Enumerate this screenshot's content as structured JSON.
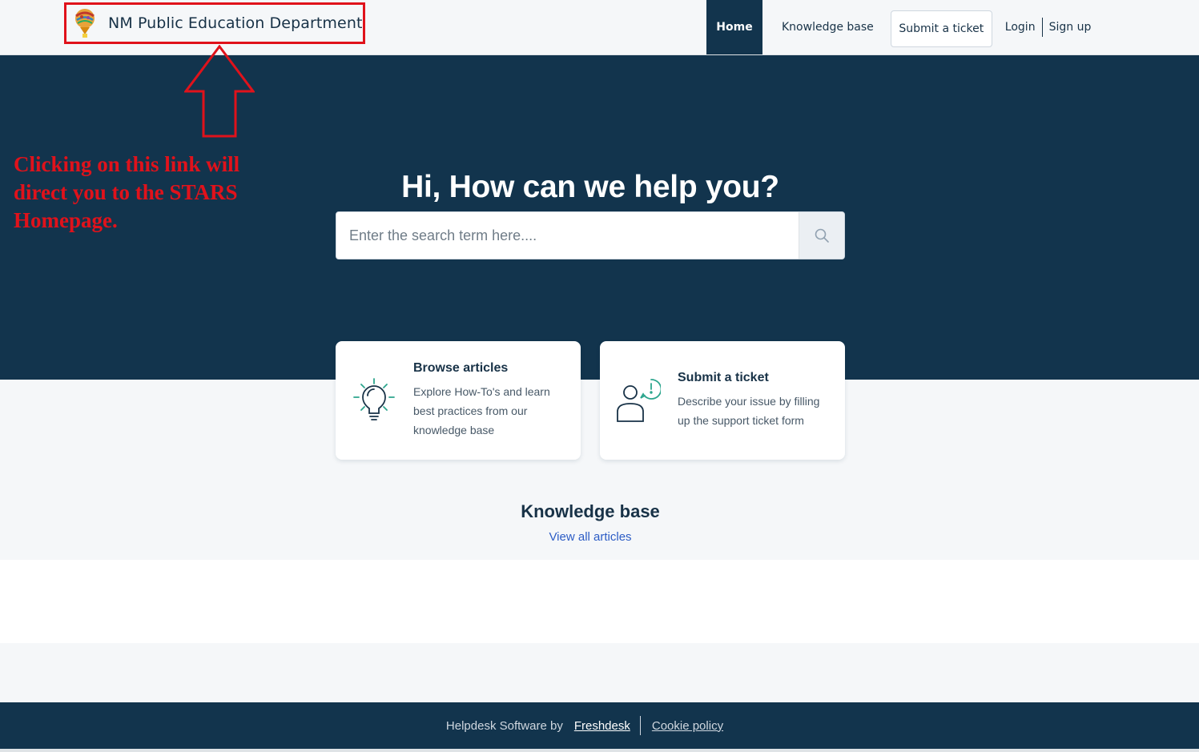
{
  "header": {
    "brand_name": "NM Public Education Department",
    "nav": {
      "home": "Home",
      "knowledge_base": "Knowledge base",
      "submit_ticket": "Submit a ticket",
      "login": "Login",
      "signup": "Sign up"
    }
  },
  "hero": {
    "title": "Hi, How can we help you?",
    "search": {
      "placeholder": "Enter the search term here....",
      "value": ""
    }
  },
  "annotation": {
    "text": "Clicking on this link will direct you to the STARS Homepage."
  },
  "cards": [
    {
      "title": "Browse articles",
      "description": "Explore How-To's and learn best practices from our knowledge base",
      "icon": "lightbulb-icon"
    },
    {
      "title": "Submit a ticket",
      "description": "Describe your issue by filling up the support ticket form",
      "icon": "user-alert-icon"
    }
  ],
  "knowledge_base": {
    "title": "Knowledge base",
    "view_all": "View all articles"
  },
  "footer": {
    "label": "Helpdesk Software by",
    "link": "Freshdesk",
    "cookie": "Cookie policy"
  },
  "colors": {
    "primary": "#12344d",
    "annotation_red": "#e0121b",
    "link_blue": "#2c5cc5",
    "accent_green": "#2ca58d"
  }
}
